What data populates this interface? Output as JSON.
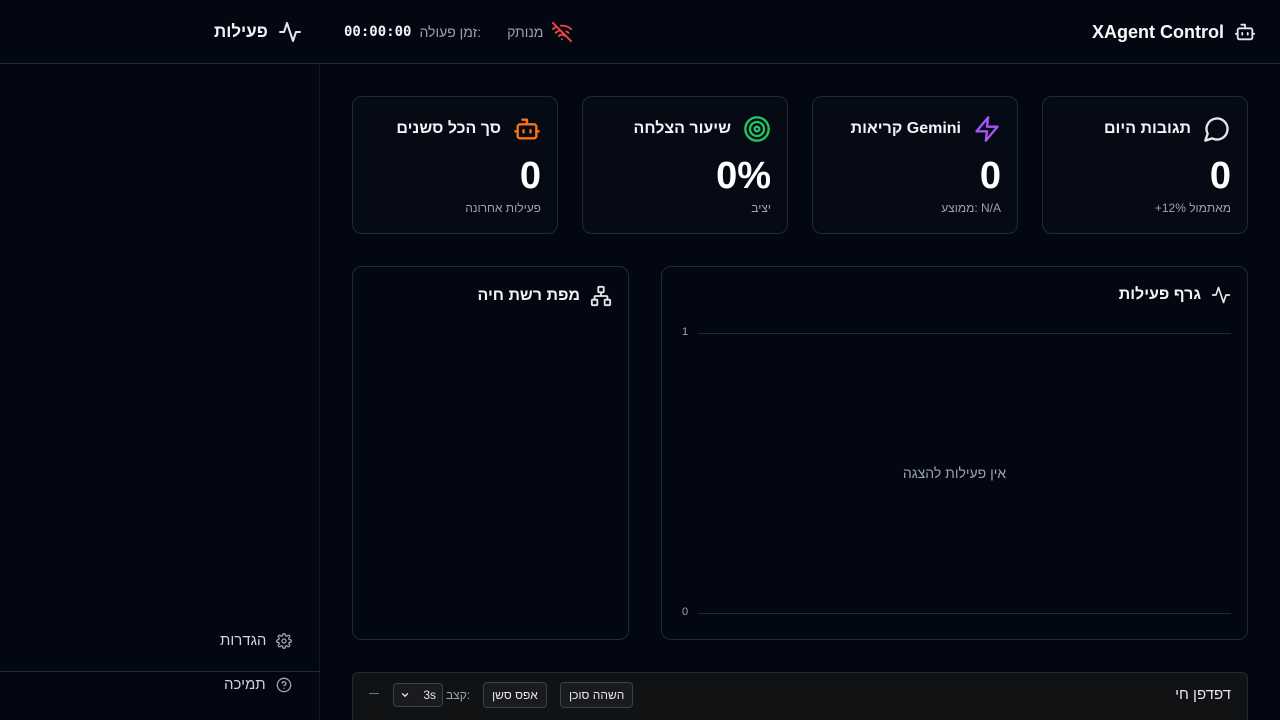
{
  "header": {
    "brand_title": "XAgent Control",
    "status_text": "מנותק",
    "uptime_label": "זמן פעולה:",
    "uptime_value": "00:00:00",
    "activity_title": "פעילות"
  },
  "sidebar": {
    "settings_label": "הגדרות",
    "support_label": "תמיכה"
  },
  "cards": [
    {
      "title": "תגובות היום",
      "value": "0",
      "sub": "+12% מאתמול",
      "icon": "message-circle-icon",
      "icon_color": "#e5e7eb"
    },
    {
      "title": "קריאות Gemini",
      "value": "0",
      "sub": "ממוצע: N/A",
      "icon": "zap-icon",
      "icon_color": "#a855f7"
    },
    {
      "title": "שיעור הצלחה",
      "value": "0%",
      "sub": "יציב",
      "icon": "target-icon",
      "icon_color": "#22c55e"
    },
    {
      "title": "סך הכל סשנים",
      "value": "0",
      "sub": "פעילות אחרונה",
      "icon": "bot-icon",
      "icon_color": "#f97316"
    }
  ],
  "activity_graph": {
    "title": "גרף פעילות",
    "empty_text": "אין פעילות להצגה",
    "chart_data": {
      "type": "line",
      "ylim": [
        0,
        1
      ],
      "ticks": [
        "1",
        "0"
      ],
      "series": []
    }
  },
  "network_map": {
    "title": "מפת רשת חיה"
  },
  "browser": {
    "title": "דפדפן חי",
    "pause_label": "השהה סוכן",
    "reset_label": "אפס סשן",
    "rate_label": "קצב:",
    "rate_value": "3s"
  },
  "colors": {
    "background": "#030712",
    "border": "#1f2937",
    "disconnected": "#ef4444"
  }
}
